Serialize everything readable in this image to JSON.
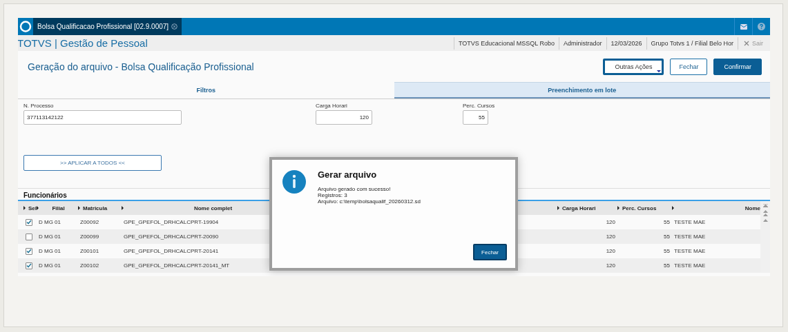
{
  "app_bar": {
    "tab_title": "Bolsa Qualificacao Profissional [02.9.0007]"
  },
  "header": {
    "product": "TOTVS | Gestão de Pessoal",
    "info": [
      "TOTVS Educacional MSSQL Robo",
      "Administrador",
      "12/03/2026",
      "Grupo Totvs 1 / Filial Belo Hor"
    ],
    "logout": "Sair"
  },
  "page": {
    "title": "Geração do arquivo - Bolsa Qualificação Profissional",
    "buttons": [
      {
        "label": "Outras Ações",
        "kind": "menu"
      },
      {
        "label": "Fechar",
        "kind": "outline"
      },
      {
        "label": "Confirmar",
        "kind": "primary"
      }
    ]
  },
  "tabs": [
    {
      "label": "Filtros",
      "selected": false
    },
    {
      "label": "Preenchimento em lote",
      "selected": true
    }
  ],
  "fields": [
    {
      "label": "N. Processo",
      "value": "377113142122",
      "kind": "text"
    },
    {
      "label": "Carga Horari",
      "value": "120",
      "kind": "number"
    },
    {
      "label": "Perc. Cursos",
      "value": "55",
      "kind": "number"
    }
  ],
  "apply_button": ">> APLICAR A TODOS <<",
  "grid": {
    "title": "Funcionários",
    "columns": [
      "Sel",
      "Filial",
      "Matricula",
      "Nome complet",
      "Carga Horari",
      "Perc. Cursos",
      "Nome"
    ],
    "rows": [
      {
        "checked": true,
        "filial": "D MG 01",
        "matricula": "Z00092",
        "nome_completo": "GPE_GPEFOL_DRHCALCPRT-19904",
        "carga": "120",
        "perc": "55",
        "nome": "TESTE MAE"
      },
      {
        "checked": false,
        "filial": "D MG 01",
        "matricula": "Z00099",
        "nome_completo": "GPE_GPEFOL_DRHCALCPRT-20090",
        "carga": "120",
        "perc": "55",
        "nome": "TESTE MAE"
      },
      {
        "checked": true,
        "filial": "D MG 01",
        "matricula": "Z00101",
        "nome_completo": "GPE_GPEFOL_DRHCALCPRT-20141",
        "carga": "120",
        "perc": "55",
        "nome": "TESTE MAE"
      },
      {
        "checked": true,
        "filial": "D MG 01",
        "matricula": "Z00102",
        "nome_completo": "GPE_GPEFOL_DRHCALCPRT-20141_MT",
        "carga": "120",
        "perc": "55",
        "nome": "TESTE MAE"
      }
    ]
  },
  "dialog": {
    "title": "Gerar arquivo",
    "lines": [
      "Arquivo gerado com sucesso!",
      "Registros: 3",
      "Arquivo: c:\\temp\\bolsaqualif_20260312.sd"
    ],
    "button": "Fechar"
  }
}
